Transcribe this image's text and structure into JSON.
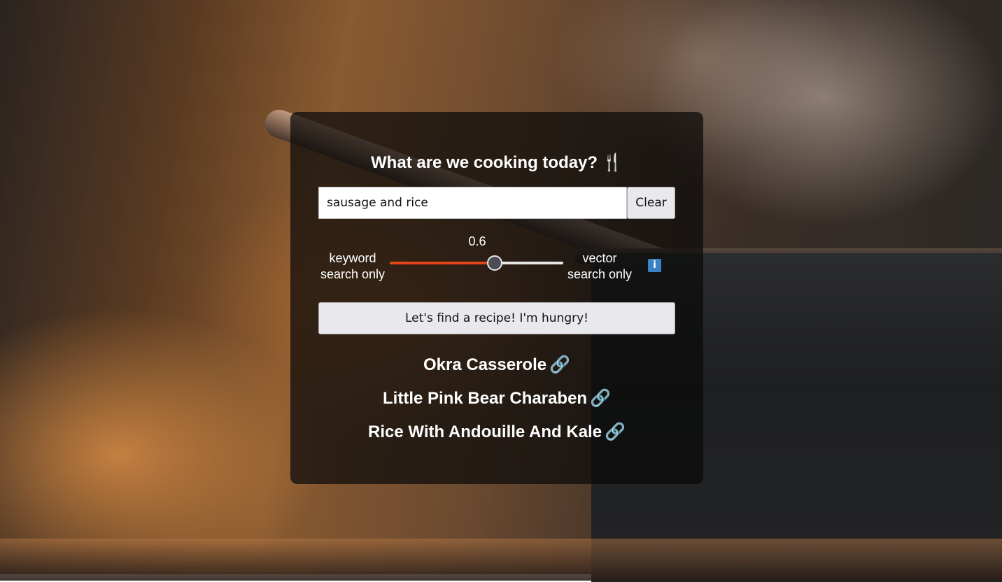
{
  "header": {
    "title": "What are we cooking today?",
    "title_icon": "fork-knife-icon"
  },
  "search": {
    "value": "sausage and rice",
    "placeholder": "",
    "clear_label": "Clear"
  },
  "slider": {
    "value": 0.6,
    "value_label": "0.6",
    "min": 0,
    "max": 1,
    "left_label_line1": "keyword",
    "left_label_line2": "search only",
    "right_label_line1": "vector",
    "right_label_line2": "search only",
    "info_icon": "info-icon",
    "fill_color": "#e0461a"
  },
  "actions": {
    "find_label": "Let's find a recipe! I'm hungry!"
  },
  "results": [
    {
      "name": "Okra Casserole",
      "icon": "link-icon"
    },
    {
      "name": "Little Pink Bear Charaben",
      "icon": "link-icon"
    },
    {
      "name": "Rice With Andouille And Kale",
      "icon": "link-icon"
    }
  ]
}
